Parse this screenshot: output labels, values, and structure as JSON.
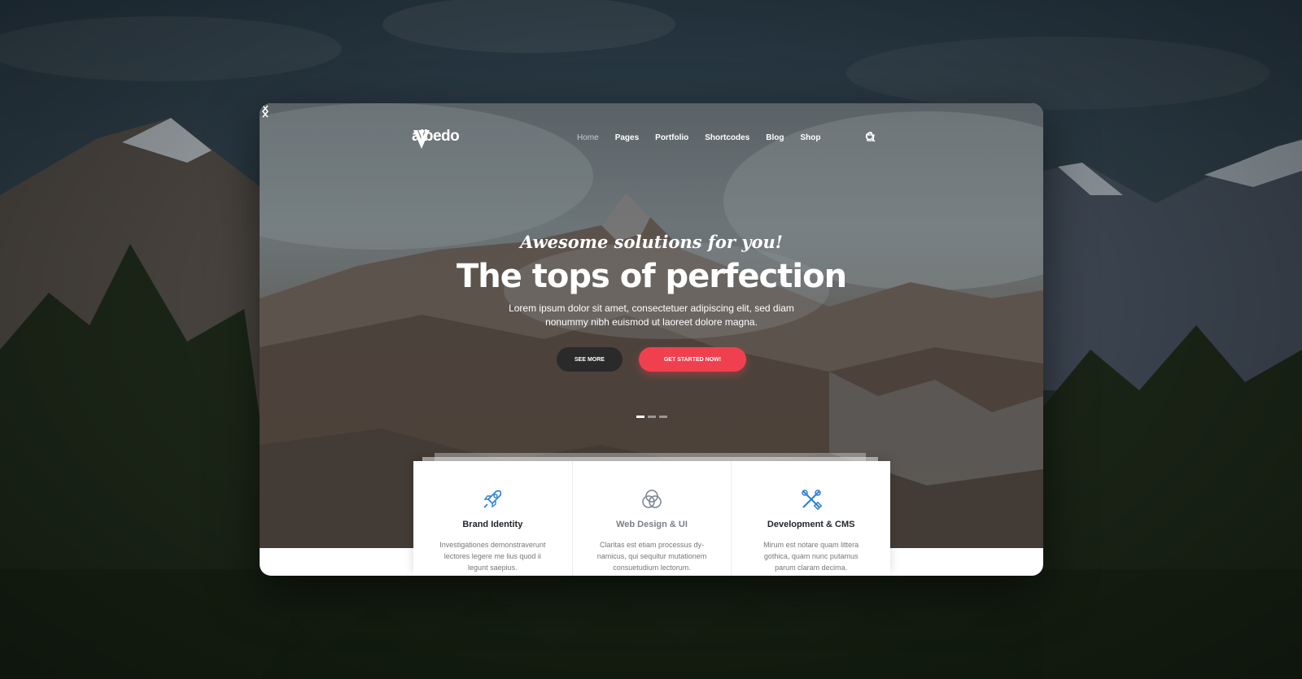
{
  "brand": {
    "name": "albedo"
  },
  "nav": {
    "items": [
      "Home",
      "Pages",
      "Portfolio",
      "Shortcodes",
      "Blog",
      "Shop"
    ],
    "active": "Home"
  },
  "hero": {
    "tagline": "Awesome solutions for you!",
    "headline": "The tops of perfection",
    "subtext": "Lorem ipsum dolor sit amet, consectetuer adipiscing elit, sed diam nonummy nibh euismod ut laoreet dolore magna.",
    "see_more": "SEE MORE",
    "get_started": "GET STARTED NOW!",
    "slides_total": 3,
    "slide_active": 1
  },
  "features": [
    {
      "title": "Brand Identity",
      "text": "Investigationes demonstraverunt lectores legere me lius quod ii legunt saepius.",
      "icon": "rocket-icon"
    },
    {
      "title": "Web Design & UI",
      "text": "Claritas est etiam processus dy- namicus, qui sequitur mutationem consuetudium lectorum.",
      "icon": "circles-icon"
    },
    {
      "title": "Development & CMS",
      "text": "Mirum est notare quam littera gothica, quam nunc putamus parum claram decima.",
      "icon": "tools-icon"
    }
  ],
  "colors": {
    "accent": "#f0404f",
    "icon_blue": "#2b7fd8",
    "dark_button": "#2a2a2a"
  }
}
